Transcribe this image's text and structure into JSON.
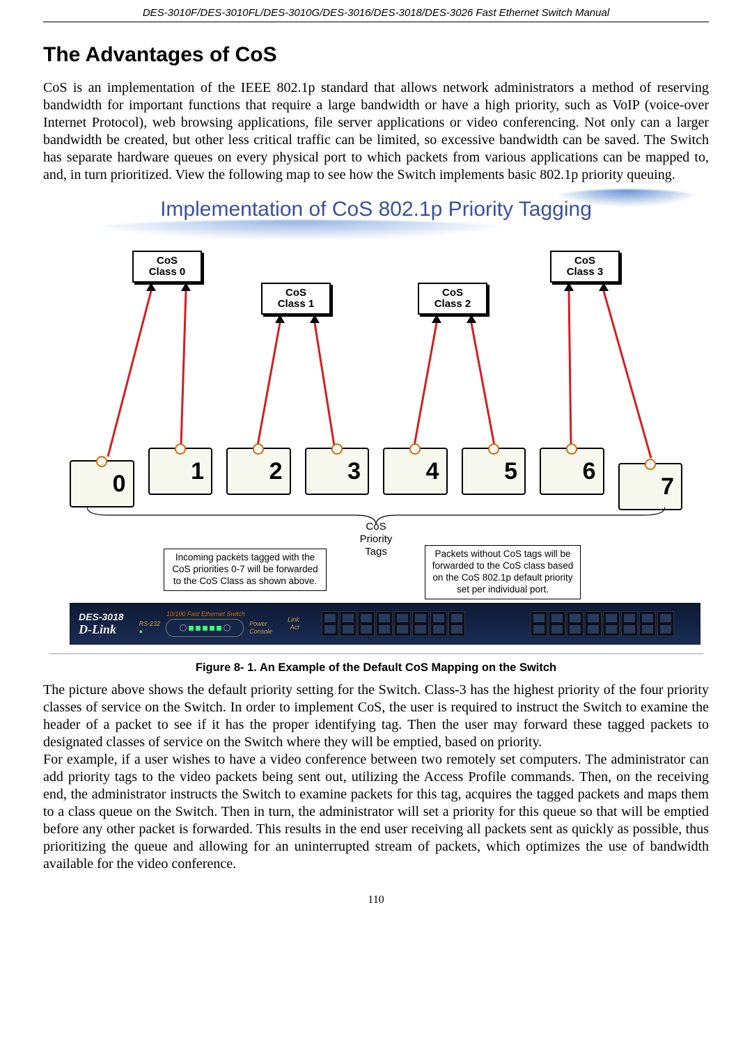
{
  "running_head": "DES-3010F/DES-3010FL/DES-3010G/DES-3016/DES-3018/DES-3026 Fast Ethernet Switch Manual",
  "section_title": "The Advantages of CoS",
  "para1": "CoS is an implementation of the IEEE 802.1p standard that allows network administrators a method of reserving bandwidth for important functions that require a large bandwidth or have a high priority, such as VoIP (voice-over Internet Protocol), web browsing applications, file server applications or video conferencing. Not only can a larger bandwidth be created, but other less critical traffic can be limited, so excessive bandwidth can be saved. The Switch has separate hardware queues on every physical port to which packets from various applications can be mapped to, and, in turn prioritized. View the following map to see how the Switch implements basic 802.1p priority queuing.",
  "figure_caption": "Figure 8- 1. An Example of the Default CoS Mapping on the Switch",
  "para2": "The picture above shows the default priority setting for the Switch. Class-3 has the highest priority of the four priority classes of service on the Switch. In order to implement CoS, the user is required to instruct the Switch to examine the header of a packet to see if it has the proper identifying tag. Then the user may forward these tagged packets to designated classes of service on the Switch where they will be emptied, based on priority.",
  "para3": "For example, if a user wishes to have a video conference between two remotely set computers. The administrator can add priority tags to the video packets being sent out, utilizing the Access Profile commands. Then, on the receiving end, the administrator instructs the Switch to examine packets for this tag, acquires the tagged packets and maps them to a class queue on the Switch. Then in turn, the administrator will set a priority for this queue so that will be emptied before any other packet is forwarded. This results in the end user receiving all packets sent as quickly as possible, thus prioritizing the queue and allowing for an uninterrupted stream of packets, which optimizes the use of bandwidth available for the video conference.",
  "page_number": "110",
  "diagram": {
    "title": "Implementation of CoS 802.1p Priority Tagging",
    "classes": {
      "c0": "CoS\nClass 0",
      "c1": "CoS\nClass 1",
      "c2": "CoS\nClass 2",
      "c3": "CoS\nClass 3"
    },
    "ports": [
      "0",
      "1",
      "2",
      "3",
      "4",
      "5",
      "6",
      "7"
    ],
    "brace_label_l1": "CoS",
    "brace_label_l2": "Priority",
    "brace_label_l3": "Tags",
    "note_left": "Incoming packets tagged with the CoS priorities 0-7 will be forwarded to the CoS Class as shown above.",
    "note_right": "Packets without CoS tags will be forwarded to the CoS class based on the CoS 802.1p default priority set per individual port.",
    "switch": {
      "model": "DES-3018",
      "tagline": "10/100 Fast Ethernet Switch",
      "brand": "D-Link",
      "label_rs232": "RS-232",
      "label_power": "Power",
      "label_console": "Console",
      "label_link": "Link",
      "label_act": "Act"
    }
  }
}
